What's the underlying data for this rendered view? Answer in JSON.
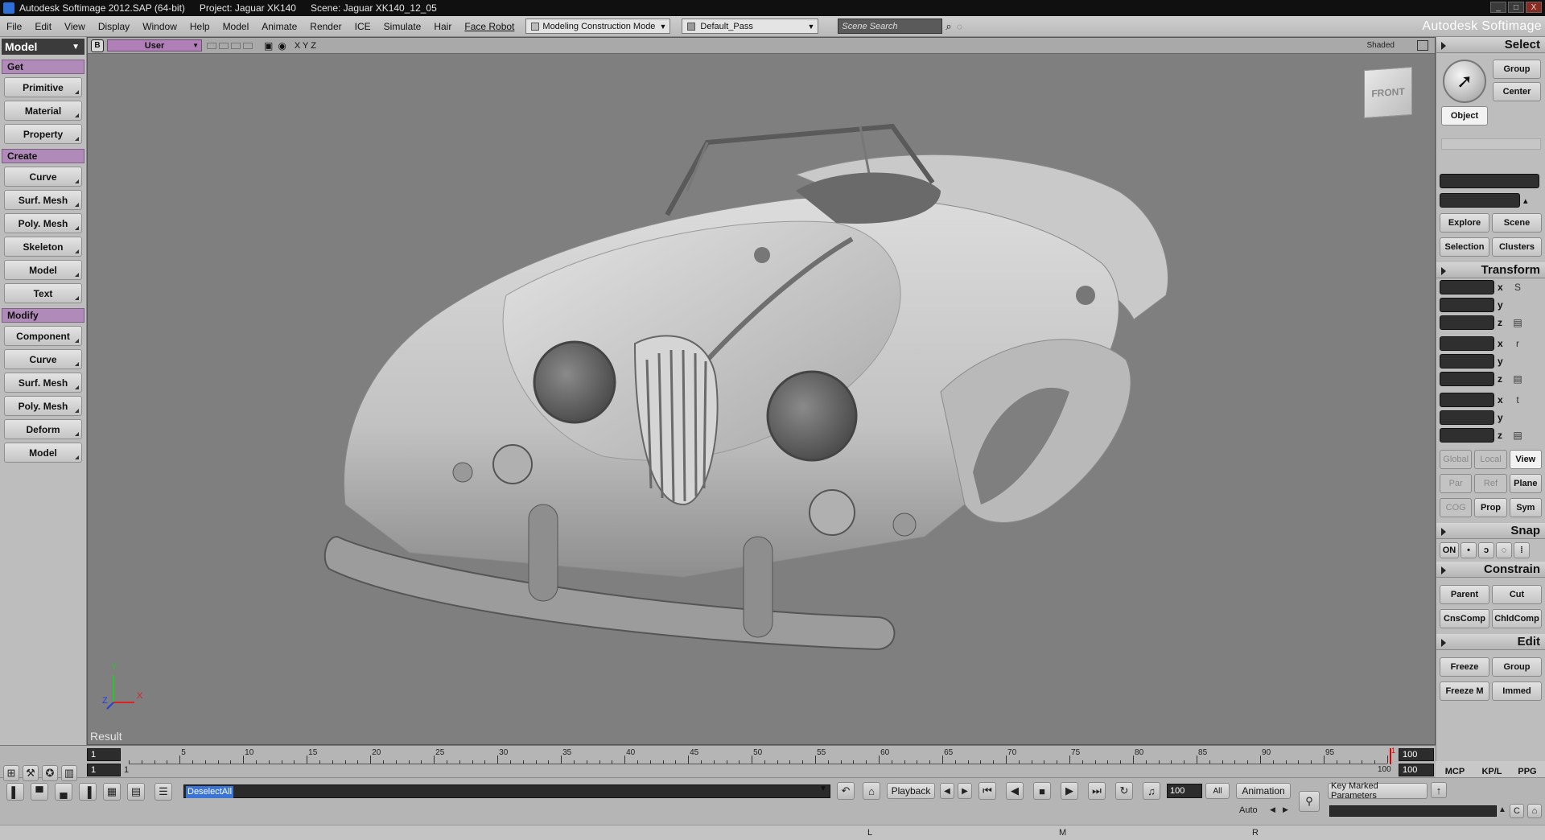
{
  "titlebar": {
    "app": "Autodesk Softimage 2012.SAP (64-bit)",
    "project": "Project: Jaguar XK140",
    "scene": "Scene: Jaguar XK140_12_05",
    "min": "_",
    "max": "□",
    "close": "X"
  },
  "menubar": {
    "items": [
      "File",
      "Edit",
      "View",
      "Display",
      "Window",
      "Help",
      "Model",
      "Animate",
      "Render",
      "ICE",
      "Simulate",
      "Hair",
      "Face Robot"
    ],
    "mode_dropdown": "Modeling Construction Mode",
    "pass_dropdown": "Default_Pass",
    "scene_search_placeholder": "Scene Search",
    "brand": "Autodesk Softimage"
  },
  "leftpanel": {
    "mode": "Model",
    "sections": [
      {
        "title": "Get",
        "buttons": [
          "Primitive",
          "Material",
          "Property"
        ]
      },
      {
        "title": "Create",
        "buttons": [
          "Curve",
          "Surf. Mesh",
          "Poly. Mesh",
          "Skeleton",
          "Model",
          "Text"
        ]
      },
      {
        "title": "Modify",
        "buttons": [
          "Component",
          "Curve",
          "Surf. Mesh",
          "Poly. Mesh",
          "Deform",
          "Model"
        ]
      }
    ]
  },
  "viewport": {
    "badge": "B",
    "camera": "User",
    "axes": "X Y Z",
    "shading": "Shaded",
    "cube_label": "FRONT",
    "gizmo_x": "X",
    "gizmo_y": "Y",
    "gizmo_z": "Z",
    "result_label": "Result"
  },
  "rightpanel": {
    "select_title": "Select",
    "group": "Group",
    "center": "Center",
    "object": "Object",
    "explore": "Explore",
    "scene": "Scene",
    "selection": "Selection",
    "clusters": "Clusters",
    "transform_title": "Transform",
    "axes": [
      "x",
      "y",
      "z"
    ],
    "transform_icons": [
      "S",
      "r",
      "t"
    ],
    "global": "Global",
    "local": "Local",
    "view": "View",
    "par": "Par",
    "ref": "Ref",
    "plane": "Plane",
    "cog": "COG",
    "prop": "Prop",
    "sym": "Sym",
    "snap_title": "Snap",
    "snap_on": "ON",
    "constrain_title": "Constrain",
    "parent": "Parent",
    "cut": "Cut",
    "cnscomp": "CnsComp",
    "chldcomp": "ChldComp",
    "edit_title": "Edit",
    "freeze": "Freeze",
    "edit_group": "Group",
    "freeze_m": "Freeze M",
    "immed": "Immed"
  },
  "timeline": {
    "start_frame": "1",
    "end_frame": "100",
    "range_start": "1",
    "range_start_label": "1",
    "range_end_label": "100",
    "range_end": "100",
    "ticks": [
      "5",
      "10",
      "15",
      "20",
      "25",
      "30",
      "35",
      "40",
      "45",
      "50",
      "55",
      "60",
      "65",
      "70",
      "75",
      "80",
      "85",
      "90",
      "95"
    ],
    "current_marker": "1"
  },
  "bottombar": {
    "command": "DeselectAll",
    "playback": "Playback",
    "frame_field": "100",
    "all": "All",
    "animation": "Animation",
    "auto": "Auto",
    "key_marked": "Key Marked Parameters",
    "tabs": [
      "MCP",
      "KP/L",
      "PPG"
    ],
    "status_letters": [
      "L",
      "M",
      "R"
    ]
  }
}
